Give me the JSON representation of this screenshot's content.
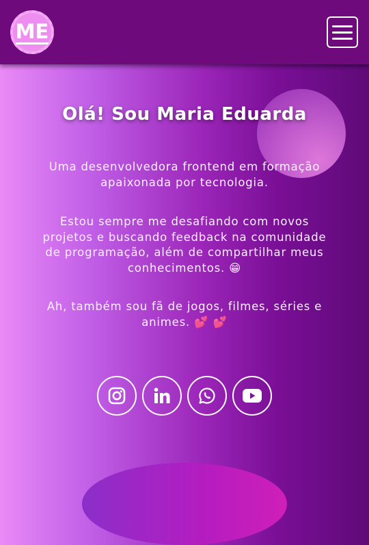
{
  "header": {
    "logo_text": "ME",
    "menu_icon": "hamburger-menu-icon"
  },
  "hero": {
    "title": "Olá! Sou Maria Eduarda",
    "paragraph_1": "Uma desenvolvedora frontend em formação apaixonada por tecnologia.",
    "paragraph_2": "Estou sempre me desafiando com novos projetos e buscando feedback na comunidade de programação, além de compartilhar meus conhecimentos. 😁",
    "paragraph_3": "Ah, também sou fã de jogos, filmes, séries e animes. 💕 💕"
  },
  "socials": [
    {
      "icon": "instagram-icon"
    },
    {
      "icon": "linkedin-icon"
    },
    {
      "icon": "whatsapp-icon"
    },
    {
      "icon": "youtube-icon"
    }
  ],
  "colors": {
    "header": "#6e0a7c",
    "logo": "#ee8ef0",
    "gradient_left": "#e98af7",
    "gradient_right": "#5f0a78"
  }
}
